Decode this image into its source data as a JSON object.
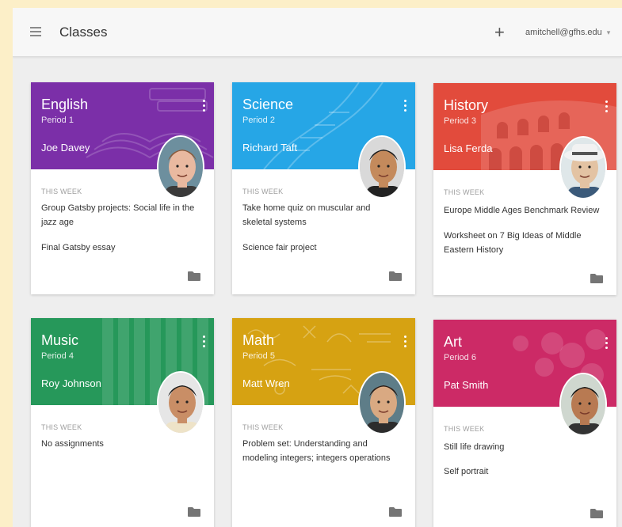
{
  "header": {
    "title": "Classes",
    "add_glyph": "+",
    "account": "amitchell@gfhs.edu",
    "account_caret": "▾"
  },
  "week_label": "THIS WEEK",
  "classes": [
    {
      "name": "English",
      "period": "Period 1",
      "teacher": "Joe Davey",
      "color": "#7b2fa8",
      "tasks": [
        "Group Gatsby projects: Social life in the jazz age",
        "Final Gatsby essay"
      ]
    },
    {
      "name": "Science",
      "period": "Period 2",
      "teacher": "Richard Taft",
      "color": "#26a6e6",
      "tasks": [
        "Take home quiz on muscular and skeletal systems",
        "Science fair project"
      ]
    },
    {
      "name": "History",
      "period": "Period 3",
      "teacher": "Lisa Ferda",
      "color": "#e24b3c",
      "tasks": [
        "Europe Middle Ages Benchmark Review",
        "Worksheet on 7 Big Ideas of Middle Eastern History"
      ]
    },
    {
      "name": "Music",
      "period": "Period 4",
      "teacher": "Roy Johnson",
      "color": "#26985a",
      "tasks": [
        "No assignments"
      ]
    },
    {
      "name": "Math",
      "period": "Period 5",
      "teacher": "Matt Wren",
      "color": "#d6a212",
      "tasks": [
        "Problem set: Understanding and modeling integers; integers operations"
      ]
    },
    {
      "name": "Art",
      "period": "Period 6",
      "teacher": "Pat Smith",
      "color": "#cc2a66",
      "tasks": [
        "Still life drawing",
        "Self portrait"
      ]
    }
  ],
  "icons": {
    "menu": "menu-icon",
    "add": "add-icon",
    "more": "more-vert-icon",
    "folder": "folder-icon",
    "avatar": "teacher-avatar"
  }
}
